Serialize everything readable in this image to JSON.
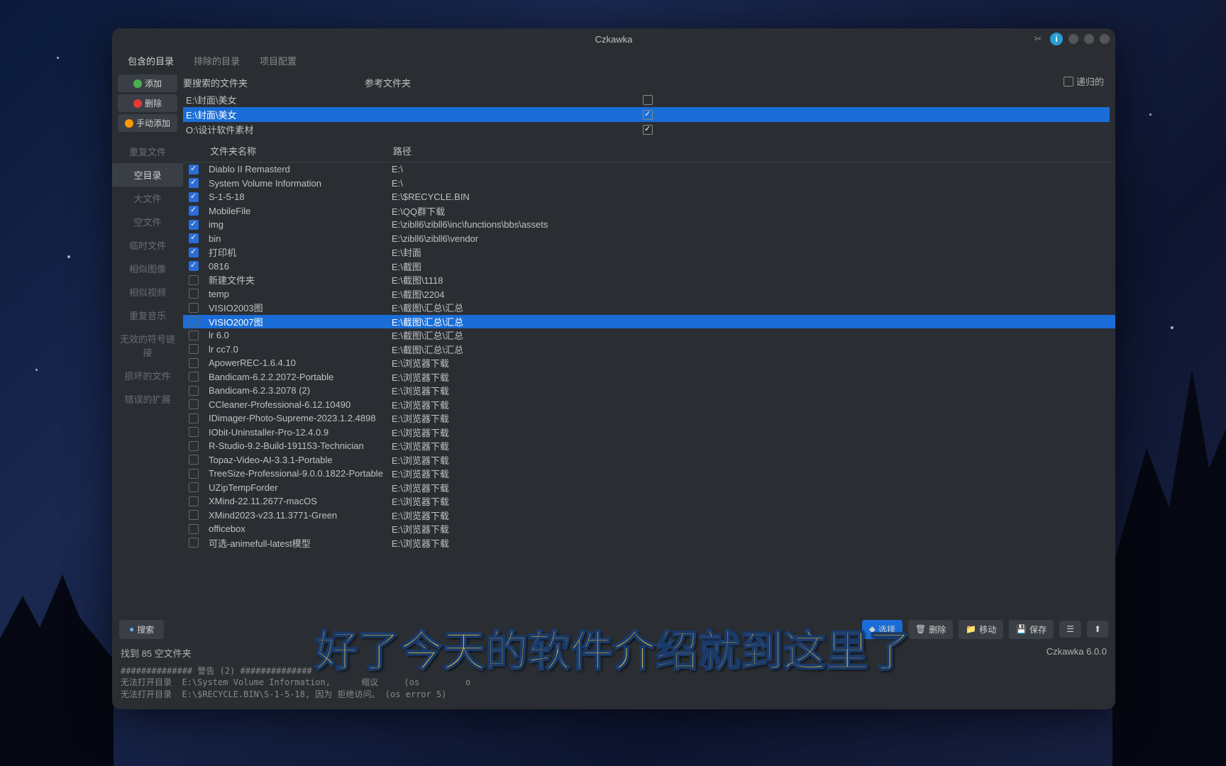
{
  "window": {
    "title": "Czkawka"
  },
  "tabs": {
    "included": "包含的目录",
    "excluded": "排除的目录",
    "config": "项目配置"
  },
  "toolbar": {
    "add": "添加",
    "delete": "删除",
    "manual": "手动添加"
  },
  "dir_headers": {
    "search": "要搜索的文件夹",
    "reference": "参考文件夹"
  },
  "recurse_label": "递归的",
  "directories": [
    {
      "path": "E:\\封面\\美女",
      "checked": false,
      "selected": false
    },
    {
      "path": "E:\\封面\\美女",
      "checked": true,
      "selected": true
    },
    {
      "path": "O:\\设计软件素材",
      "checked": true,
      "selected": false
    }
  ],
  "sidebar": [
    {
      "label": "重复文件",
      "active": false
    },
    {
      "label": "空目录",
      "active": true
    },
    {
      "label": "大文件",
      "active": false
    },
    {
      "label": "空文件",
      "active": false
    },
    {
      "label": "临时文件",
      "active": false
    },
    {
      "label": "相似图像",
      "active": false
    },
    {
      "label": "相似视频",
      "active": false
    },
    {
      "label": "重复音乐",
      "active": false
    },
    {
      "label": "无效的符号链接",
      "active": false
    },
    {
      "label": "损坏的文件",
      "active": false
    },
    {
      "label": "错误的扩展",
      "active": false
    }
  ],
  "result_headers": {
    "name": "文件夹名称",
    "path": "路径"
  },
  "results": [
    {
      "checked": true,
      "name": "Diablo II Remasterd",
      "path": "E:\\"
    },
    {
      "checked": true,
      "name": "System Volume Information",
      "path": "E:\\"
    },
    {
      "checked": true,
      "name": "S-1-5-18",
      "path": "E:\\$RECYCLE.BIN"
    },
    {
      "checked": true,
      "name": "MobileFile",
      "path": "E:\\QQ群下载"
    },
    {
      "checked": true,
      "name": "img",
      "path": "E:\\zibll6\\zibll6\\inc\\functions\\bbs\\assets"
    },
    {
      "checked": true,
      "name": "bin",
      "path": "E:\\zibll6\\zibll6\\vendor"
    },
    {
      "checked": true,
      "name": "打印机",
      "path": "E:\\封面"
    },
    {
      "checked": true,
      "name": "0816",
      "path": "E:\\截图"
    },
    {
      "checked": false,
      "name": "新建文件夹",
      "path": "E:\\截图\\1118"
    },
    {
      "checked": false,
      "name": "temp",
      "path": "E:\\截图\\2204"
    },
    {
      "checked": false,
      "name": "VISIO2003图",
      "path": "E:\\截图\\汇总\\汇总"
    },
    {
      "checked": false,
      "name": "VISIO2007图",
      "path": "E:\\截图\\汇总\\汇总",
      "selected": true
    },
    {
      "checked": false,
      "name": "lr 6.0",
      "path": "E:\\截图\\汇总\\汇总"
    },
    {
      "checked": false,
      "name": "lr cc7.0",
      "path": "E:\\截图\\汇总\\汇总"
    },
    {
      "checked": false,
      "name": "ApowerREC-1.6.4.10",
      "path": "E:\\浏览器下载"
    },
    {
      "checked": false,
      "name": "Bandicam-6.2.2.2072-Portable",
      "path": "E:\\浏览器下载"
    },
    {
      "checked": false,
      "name": "Bandicam-6.2.3.2078 (2)",
      "path": "E:\\浏览器下载"
    },
    {
      "checked": false,
      "name": "CCleaner-Professional-6.12.10490",
      "path": "E:\\浏览器下载"
    },
    {
      "checked": false,
      "name": "IDimager-Photo-Supreme-2023.1.2.4898",
      "path": "E:\\浏览器下载"
    },
    {
      "checked": false,
      "name": "IObit-Uninstaller-Pro-12.4.0.9",
      "path": "E:\\浏览器下载"
    },
    {
      "checked": false,
      "name": "R-Studio-9.2-Build-191153-Technician",
      "path": "E:\\浏览器下载"
    },
    {
      "checked": false,
      "name": "Topaz-Video-AI-3.3.1-Portable",
      "path": "E:\\浏览器下载"
    },
    {
      "checked": false,
      "name": "TreeSize-Professional-9.0.0.1822-Portable",
      "path": "E:\\浏览器下载"
    },
    {
      "checked": false,
      "name": "UZipTempForder",
      "path": "E:\\浏览器下载"
    },
    {
      "checked": false,
      "name": "XMind-22.11.2677-macOS",
      "path": "E:\\浏览器下载"
    },
    {
      "checked": false,
      "name": "XMind2023-v23.11.3771-Green",
      "path": "E:\\浏览器下载"
    },
    {
      "checked": false,
      "name": "officebox",
      "path": "E:\\浏览器下载"
    },
    {
      "checked": false,
      "name": "可选-animefull-latest模型",
      "path": "E:\\浏览器下载"
    }
  ],
  "bottombar": {
    "search": "搜索",
    "select": "选择",
    "delete": "删除",
    "move": "移动",
    "save": "保存"
  },
  "status": {
    "found": "找到 85 空文件夹",
    "version": "Czkawka 6.0.0"
  },
  "log": "############## 警告 (2) ##############\n无法打开目录  E:\\System Volume Information,      缩议     (os         o\n无法打开目录  E:\\$RECYCLE.BIN\\S-1-5-18, 因为 拒绝访问。 (os error 5)",
  "subtitle": "好了今天的软件介绍就到这里了"
}
